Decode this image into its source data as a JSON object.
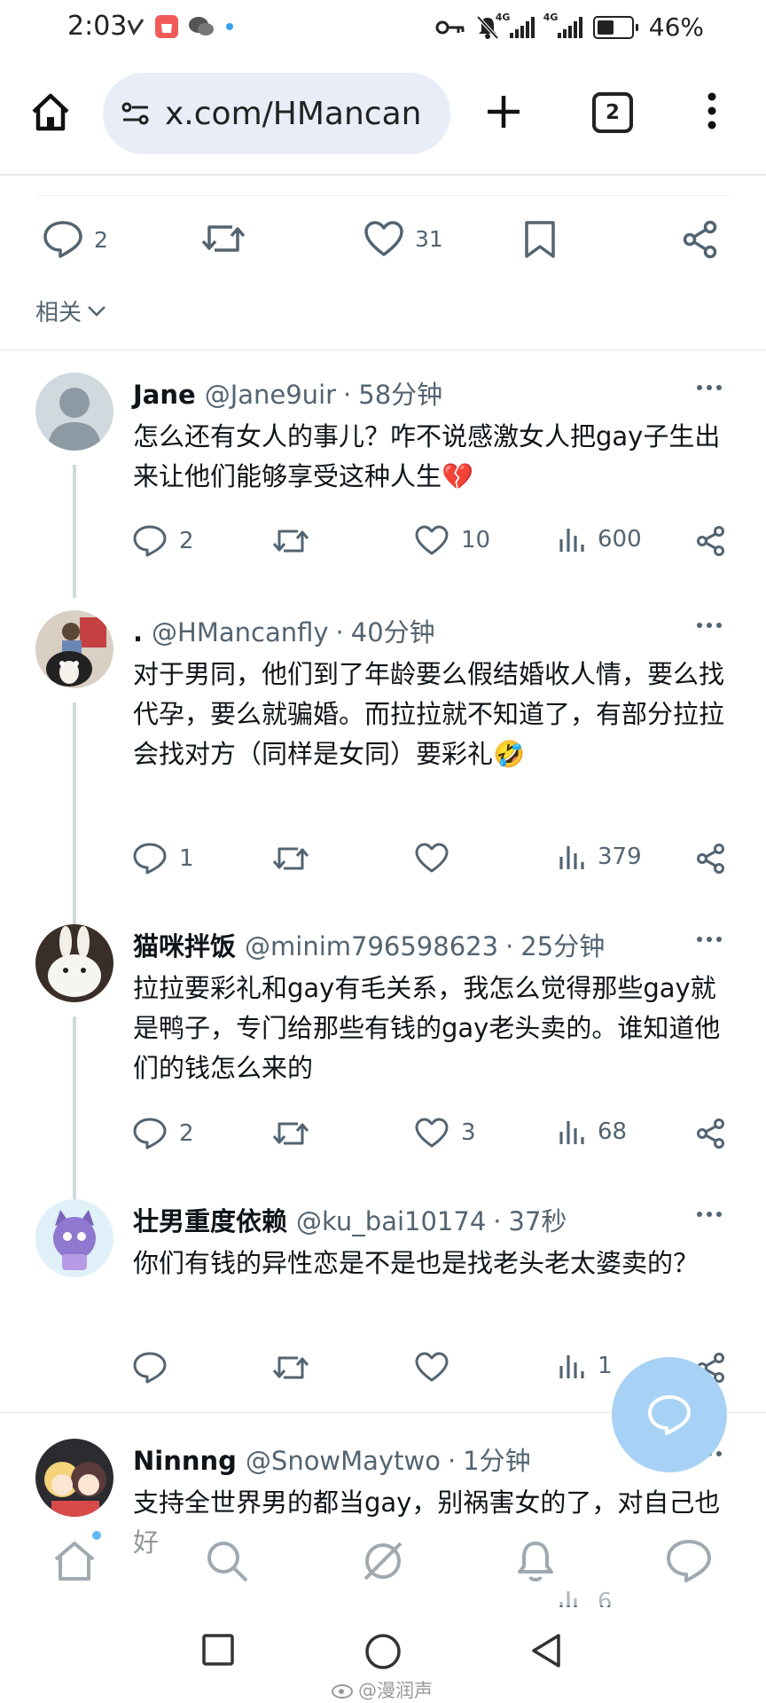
{
  "status_bar": {
    "time": "2:03",
    "battery": "46%",
    "network_1": "4G",
    "network_2": "4G",
    "icons": [
      "key-icon",
      "mute-bell-icon",
      "signal-icon",
      "signal-icon",
      "battery-icon"
    ]
  },
  "browser": {
    "url": "x.com/HMancan",
    "tab_count": "2"
  },
  "main_post": {
    "replies": "2",
    "retweets": "",
    "likes": "31",
    "related_label": "相关"
  },
  "replies": [
    {
      "name": "Jane",
      "handle": "@Jane9uir",
      "time": "58分钟",
      "text": "怎么还有女人的事儿？咋不说感激女人把gay子生出来让他们能够享受这种人生💔",
      "replies": "2",
      "likes": "10",
      "views": "600"
    },
    {
      "name": ".",
      "handle": "@HMancanfly",
      "time": "40分钟",
      "text": "对于男同，他们到了年龄要么假结婚收人情，要么找代孕，要么就骗婚。而拉拉就不知道了，有部分拉拉会找对方（同样是女同）要彩礼🤣",
      "replies": "1",
      "likes": "",
      "views": "379"
    },
    {
      "name": "猫咪拌饭",
      "handle": "@minim796598623",
      "time": "25分钟",
      "text": "拉拉要彩礼和gay有毛关系，我怎么觉得那些gay就是鸭子，专门给那些有钱的gay老头卖的。谁知道他们的钱怎么来的",
      "replies": "2",
      "likes": "3",
      "views": "68"
    },
    {
      "name": "壮男重度依赖",
      "handle": "@ku_bai10174",
      "time": "37秒",
      "text": "你们有钱的异性恋是不是也是找老头老太婆卖的？",
      "replies": "",
      "likes": "",
      "views": "1"
    },
    {
      "name": "Ninnng",
      "handle": "@SnowMaytwo",
      "time": "1分钟",
      "text": "支持全世界男的都当gay，别祸害女的了，对自己也好",
      "replies": "",
      "likes": "",
      "views": "6"
    }
  ],
  "watermark": "@漫润声",
  "colors": {
    "text": "#0f1419",
    "secondary": "#536471",
    "thread_line": "#cfd9de",
    "fab": "#a7d2f5",
    "url_bar": "#e8edf7"
  }
}
